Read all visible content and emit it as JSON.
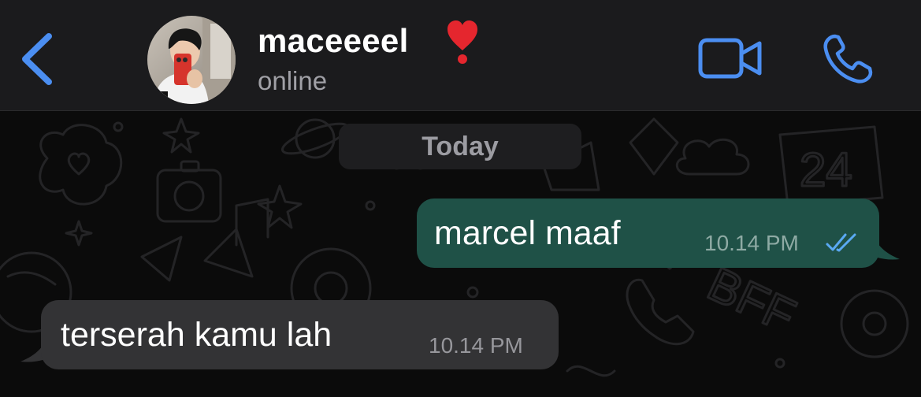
{
  "header": {
    "back_icon": "chevron-left-icon",
    "contact_name": "maceeeel",
    "contact_emoji": "heart-exclamation-icon",
    "contact_status": "online",
    "video_icon": "video-camera-icon",
    "call_icon": "phone-icon",
    "accent_color": "#4b8ef1"
  },
  "chat": {
    "date_separator": "Today",
    "messages": [
      {
        "direction": "outgoing",
        "text": "marcel maaf",
        "time": "10.14 PM",
        "status_icon": "double-check-read-icon",
        "bubble_color": "#1f5147"
      },
      {
        "direction": "incoming",
        "text": "terserah kamu lah",
        "time": "10.14 PM",
        "bubble_color": "#333335"
      }
    ]
  }
}
